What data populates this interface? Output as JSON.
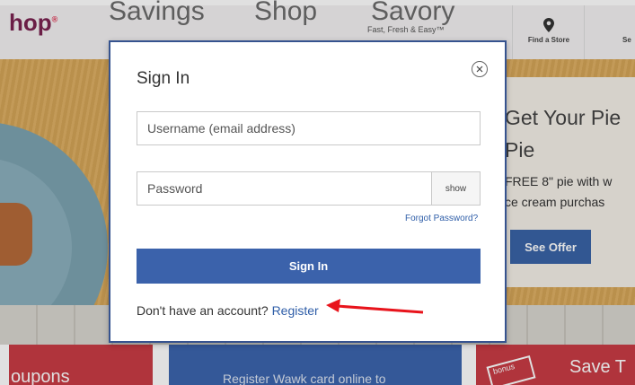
{
  "nav": {
    "logo": "hop",
    "logo_mark": "®",
    "items": [
      "Savings",
      "Shop",
      "Savory"
    ],
    "savory_subtitle": "Fast, Fresh & Easy™",
    "find_store": "Find a Store",
    "next_util": "Se"
  },
  "hero": {
    "title_line1": "Get Your Pie",
    "title_line2": "Pie",
    "text_line1": "FREE 8\" pie with w",
    "text_line2": "ce cream purchas",
    "cta": "See Offer"
  },
  "bottom": {
    "coupons": "oupons",
    "register_card": "Register Wawk card online to",
    "bonus": "bonus",
    "save": "Save T"
  },
  "modal": {
    "title": "Sign In",
    "username_placeholder": "Username (email address)",
    "password_placeholder": "Password",
    "show_label": "show",
    "forgot_label": "Forgot Password?",
    "signin_label": "Sign In",
    "no_account_text": "Don't have an account?",
    "register_label": "Register"
  },
  "colors": {
    "primary_button": "#3b62ab",
    "link": "#2f5ea8",
    "annotation_arrow": "#e8141c"
  },
  "icons": {
    "close": "close-circle-icon",
    "store": "map-pin-icon",
    "annotation": "red-arrow-icon"
  }
}
